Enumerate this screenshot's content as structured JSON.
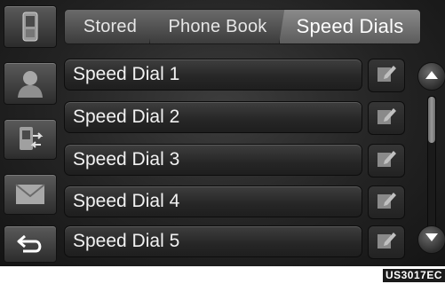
{
  "sidebar": {
    "buttons": [
      {
        "icon": "phone-icon"
      },
      {
        "icon": "contact-icon"
      },
      {
        "icon": "transfer-icon"
      },
      {
        "icon": "message-icon"
      },
      {
        "icon": "back-icon"
      }
    ]
  },
  "tabs": [
    {
      "label": "Stored"
    },
    {
      "label": "Phone Book"
    },
    {
      "label": "Speed Dials",
      "selected": true
    }
  ],
  "speed_dials": [
    {
      "label": "Speed Dial 1"
    },
    {
      "label": "Speed Dial 2"
    },
    {
      "label": "Speed Dial 3"
    },
    {
      "label": "Speed Dial 4"
    },
    {
      "label": "Speed Dial 5"
    }
  ],
  "edit_icon": "edit-icon",
  "scroll": {
    "up_icon": "arrow-up-icon",
    "down_icon": "arrow-down-icon",
    "position_fraction": 0.0,
    "visible_fraction": 0.35
  },
  "figure_code": "US3017EC",
  "colors": {
    "background": "#232323",
    "text": "#f2f2f2",
    "selected_tab": "#7a7a7a"
  }
}
